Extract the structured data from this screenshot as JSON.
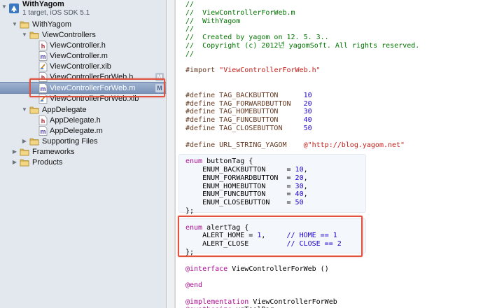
{
  "navigator": {
    "project": {
      "name": "WithYagom",
      "subtitle": "1 target, iOS SDK 5.1"
    },
    "items": [
      {
        "label": "WithYagom",
        "kind": "group"
      },
      {
        "label": "ViewControllers",
        "kind": "group"
      },
      {
        "label": "ViewController.h",
        "kind": "h"
      },
      {
        "label": "ViewController.m",
        "kind": "m"
      },
      {
        "label": "ViewController.xib",
        "kind": "xib"
      },
      {
        "label": "ViewControllerForWeb.h",
        "kind": "h",
        "badge": "M"
      },
      {
        "label": "ViewControllerForWeb.m",
        "kind": "m",
        "badge": "M",
        "selected": true
      },
      {
        "label": "ViewControllerForWeb.xib",
        "kind": "xib"
      },
      {
        "label": "AppDelegate",
        "kind": "group"
      },
      {
        "label": "AppDelegate.h",
        "kind": "h"
      },
      {
        "label": "AppDelegate.m",
        "kind": "m"
      },
      {
        "label": "Supporting Files",
        "kind": "group"
      },
      {
        "label": "Frameworks",
        "kind": "group"
      },
      {
        "label": "Products",
        "kind": "group"
      }
    ]
  },
  "editor": {
    "lines": [
      {
        "t": "//",
        "c": "comment"
      },
      {
        "t": "//  ViewControllerForWeb.m",
        "c": "comment"
      },
      {
        "t": "//  WithYagom",
        "c": "comment"
      },
      {
        "t": "//",
        "c": "comment"
      },
      {
        "t": "//  Created by yagom on 12. 5. 3..",
        "c": "comment"
      },
      {
        "t": "//  Copyright (c) 2012년 yagomSoft. All rights reserved.",
        "c": "comment"
      },
      {
        "t": "//",
        "c": "comment"
      },
      {
        "t": "",
        "c": ""
      },
      {
        "t": "#import \"ViewControllerForWeb.h\"",
        "c": "import"
      },
      {
        "t": "",
        "c": ""
      },
      {
        "t": "",
        "c": ""
      },
      {
        "t": "#define TAG_BACKBUTTON      10",
        "c": "define"
      },
      {
        "t": "#define TAG_FORWARDBUTTON   20",
        "c": "define"
      },
      {
        "t": "#define TAG_HOMEBUTTON      30",
        "c": "define"
      },
      {
        "t": "#define TAG_FUNCBUTTON      40",
        "c": "define"
      },
      {
        "t": "#define TAG_CLOSEBUTTON     50",
        "c": "define"
      },
      {
        "t": "",
        "c": ""
      },
      {
        "t": "#define URL_STRING_YAGOM    @\"http://blog.yagom.net\"",
        "c": "define-str"
      },
      {
        "t": "",
        "c": ""
      },
      {
        "t": "enum buttonTag {",
        "c": "enum"
      },
      {
        "t": "    ENUM_BACKBUTTON     = 10,",
        "c": "enumval"
      },
      {
        "t": "    ENUM_FORWARDBUTTON  = 20,",
        "c": "enumval"
      },
      {
        "t": "    ENUM_HOMEBUTTON     = 30,",
        "c": "enumval"
      },
      {
        "t": "    ENUM_FUNCBUTTON     = 40,",
        "c": "enumval"
      },
      {
        "t": "    ENUM_CLOSEBUTTON    = 50",
        "c": "enumval"
      },
      {
        "t": "};",
        "c": ""
      },
      {
        "t": "",
        "c": ""
      },
      {
        "t": "enum alertTag {",
        "c": "enum"
      },
      {
        "t": "    ALERT_HOME = 1,     // HOME == 1",
        "c": "alert"
      },
      {
        "t": "    ALERT_CLOSE         // CLOSE == 2",
        "c": "alert"
      },
      {
        "t": "};",
        "c": ""
      },
      {
        "t": "",
        "c": ""
      },
      {
        "t": "@interface ViewControllerForWeb ()",
        "c": "atdecl"
      },
      {
        "t": "",
        "c": ""
      },
      {
        "t": "@end",
        "c": "at"
      },
      {
        "t": "",
        "c": ""
      },
      {
        "t": "@implementation ViewControllerForWeb",
        "c": "atdecl"
      },
      {
        "t": "@synthesize yqToolBar;",
        "c": "atdecl"
      }
    ]
  },
  "colors": {
    "comment": "#007400",
    "preprocessor": "#643820",
    "string": "#c41a16",
    "keyword": "#aa0d91",
    "number": "#1c00cf",
    "highlight": "#e0533f"
  },
  "icons": {
    "group": "folder-icon",
    "h": "header-file-icon",
    "m": "implementation-file-icon",
    "xib": "interface-builder-file-icon",
    "project": "xcode-project-icon"
  }
}
